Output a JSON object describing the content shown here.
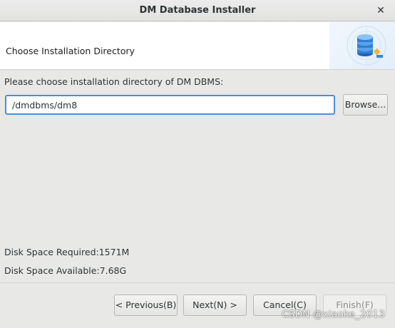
{
  "window": {
    "title": "DM Database Installer",
    "close_glyph": "✕",
    "close_icon": "close-icon"
  },
  "header": {
    "heading": "Choose Installation Directory",
    "logo_icon": "database-icon"
  },
  "main": {
    "prompt": "Please choose installation directory of DM DBMS:",
    "directory_value": "/dmdbms/dm8",
    "browse_label": "Browse...",
    "disk_required": "Disk Space Required:1571M",
    "disk_available": "Disk Space Available:7.68G"
  },
  "footer": {
    "previous_label": "< Previous(B)",
    "next_label": "Next(N) >",
    "cancel_label": "Cancel(C)",
    "finish_label": "Finish(F)"
  },
  "watermark": "CSDN @xiaoke_2013",
  "colors": {
    "accent": "#4a90d9",
    "database_blue": "#2f7fd6"
  }
}
